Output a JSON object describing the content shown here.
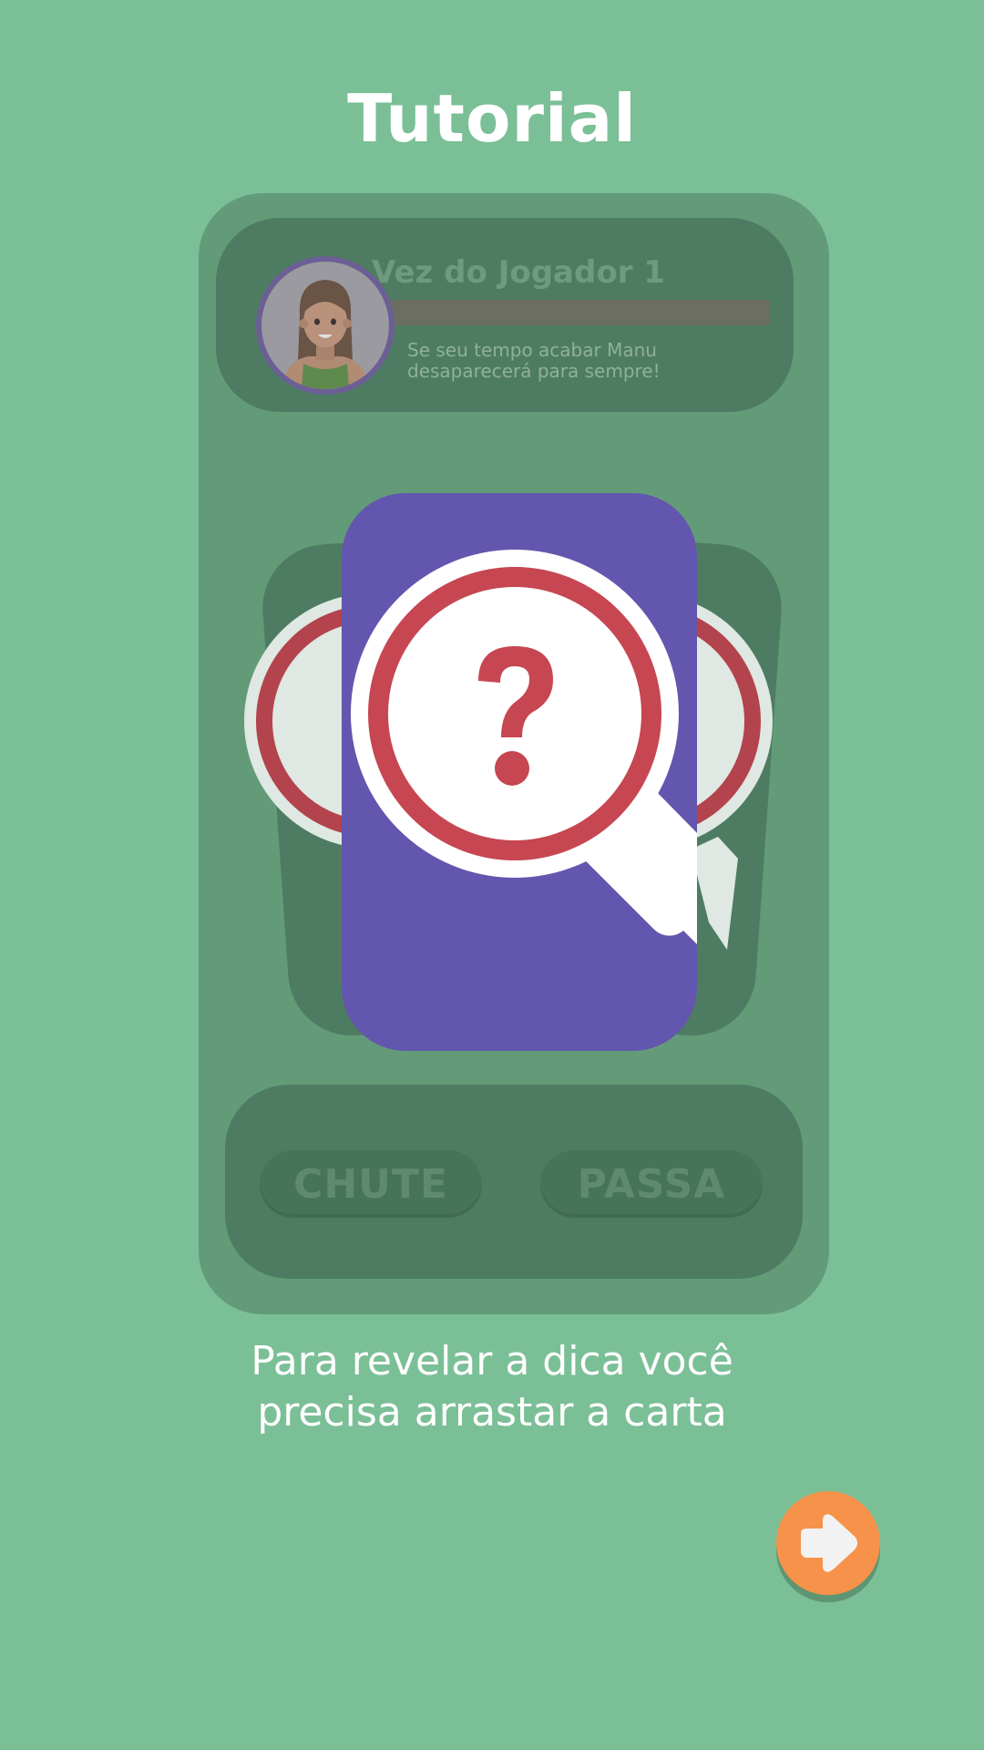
{
  "screen": {
    "title": "Tutorial",
    "instructions_line1": "Para revelar a dica você",
    "instructions_line2": "precisa arrastar a carta"
  },
  "game_preview": {
    "turn_label": "Vez do Jogador 1",
    "timer_warning_line1": "Se seu tempo acabar Manu",
    "timer_warning_line2": "desaparecerá para sempre!",
    "avatar_icon": "girl-avatar-icon",
    "card_icon": "magnifier-question-icon",
    "buttons": {
      "guess_label": "CHUTE",
      "pass_label": "PASSA"
    }
  },
  "navigation": {
    "next_icon": "arrow-right-icon"
  },
  "colors": {
    "background": "#7bbf97",
    "card": "#6356ae",
    "accent_red": "#c64651",
    "next_button": "#f7924a"
  }
}
